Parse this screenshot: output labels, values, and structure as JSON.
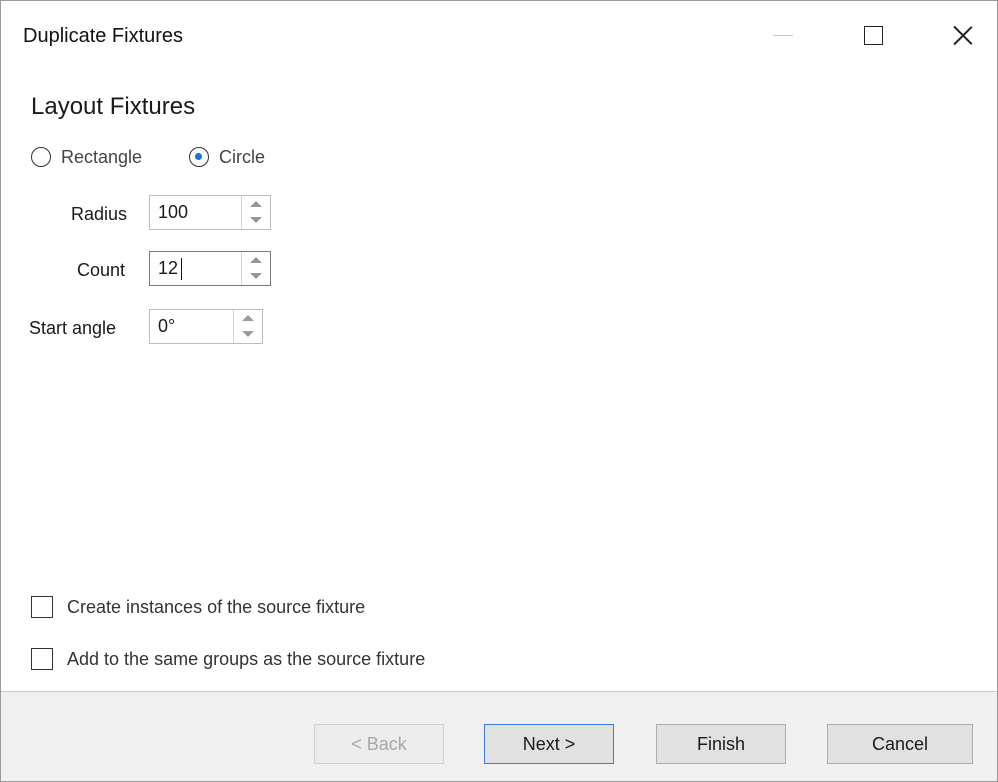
{
  "window": {
    "title": "Duplicate Fixtures"
  },
  "page": {
    "heading": "Layout Fixtures"
  },
  "layout_mode": {
    "options": [
      {
        "label": "Rectangle",
        "selected": false
      },
      {
        "label": "Circle",
        "selected": true
      }
    ]
  },
  "fields": {
    "radius": {
      "label": "Radius",
      "value": "100"
    },
    "count": {
      "label": "Count",
      "value": "12"
    },
    "start_angle": {
      "label": "Start angle",
      "value": "0°"
    }
  },
  "options": {
    "create_instances": {
      "label": "Create instances of the source fixture",
      "checked": false
    },
    "same_groups": {
      "label": "Add to the same groups as the source fixture",
      "checked": false
    }
  },
  "buttons": {
    "back": {
      "label": "< Back",
      "enabled": false
    },
    "next": {
      "label": "Next >",
      "enabled": true
    },
    "finish": {
      "label": "Finish",
      "enabled": true
    },
    "cancel": {
      "label": "Cancel",
      "enabled": true
    }
  },
  "icons": {
    "minimize": "minimize-icon",
    "maximize": "maximize-icon",
    "close": "close-icon",
    "spin_up": "chevron-up-icon",
    "spin_down": "chevron-down-icon"
  },
  "colors": {
    "accent": "#1f6fd6",
    "footer_background": "#f0f0f0",
    "default_button_border": "#3b7fd1"
  }
}
